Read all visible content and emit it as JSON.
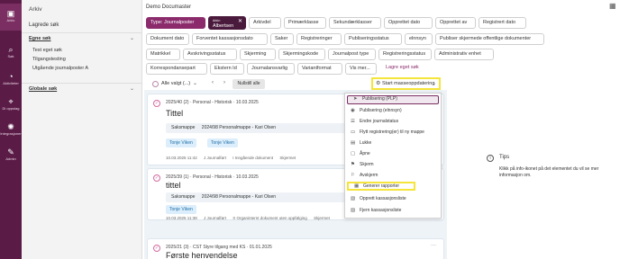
{
  "rail": [
    {
      "label": "Arkiv",
      "icon": "folder-icon",
      "glyph": "▣"
    },
    {
      "label": "Søk",
      "icon": "search-icon",
      "glyph": "⌕"
    },
    {
      "label": "Aktiviteter",
      "icon": "activity-icon",
      "glyph": "◔"
    },
    {
      "label": "Di oppslag",
      "icon": "map-pin-icon",
      "glyph": "⌖"
    },
    {
      "label": "Integrasjoner",
      "icon": "cog-icon",
      "glyph": "✺"
    },
    {
      "label": "Admin",
      "icon": "tools-icon",
      "glyph": "✎"
    }
  ],
  "left_panel": {
    "title": "Arkiv",
    "saved_search": "Lagrede søk",
    "own_section": "Egne søk",
    "own_items": [
      "Test eget søk",
      "Tilgangstesting",
      "Utgående journalposter A"
    ],
    "global_section": "Globale søk",
    "chevron": "⌄"
  },
  "header": {
    "title": "Demo Documaster",
    "icon_glyph": "▦"
  },
  "chips": {
    "type_filter": "Type: Journalposter",
    "owner_small": "Arkiv:",
    "owner_value": "Albertsen",
    "close": "✕",
    "row1": [
      "Arkivdel",
      "Primærklasse",
      "Sekundærklasser",
      "Opprettet dato",
      "Opprettet av",
      "Registrert dato"
    ],
    "row2": [
      "Dokument dato",
      "Forventet kassasjonsdato",
      "Saker",
      "Registreringer",
      "Publiseringsstatus",
      "elnnsyn",
      "Publiser skjermede offentlige dokumenter"
    ],
    "row3": [
      "Matrikkel",
      "Avskrivingsstatus",
      "Skjerming",
      "Skjermingskode",
      "Journalpost type",
      "Registreringsstatus",
      "Administrativ enhet"
    ],
    "row4": [
      "Korrespondansepart",
      "Ekstern Id",
      "Journalansvarlig",
      "Variantformat",
      "Vis mer..."
    ],
    "save_search": "Lagre eget søk"
  },
  "toolbar": {
    "select_all": "Alle valgt (...)",
    "select_all_chev": "⌄",
    "prev": "‹",
    "next": "›",
    "reset": "Nullstill alle",
    "mass_update": "Start masseoppdatering",
    "mass_cog": "⚙",
    "mass_chev": "⌄"
  },
  "cards": [
    {
      "check": "✓",
      "meta": "2025/40 (2)  ·  Personal - Historisk  ·  10.03.2025",
      "dots": "···",
      "title": "Tittel",
      "sub_label": "Saksmappe",
      "sub_value": "2024/98  Personalmappe - Kari Olsen",
      "tags": [
        "Tonje Viken",
        "Tonje Viken"
      ],
      "foot": [
        "10.03.2025 11:42",
        "J  Journalført",
        "I  Inngående dokument",
        "Skjermet"
      ]
    },
    {
      "check": "✓",
      "meta": "2025/39 (1)  ·  Personal - Historisk  ·  10.03.2025",
      "dots": "···",
      "title": "tittel",
      "sub_label": "Saksmappe",
      "sub_value": "2024/98  Personalmappe - Kari Olsen",
      "tags": [
        "Tonje Viken"
      ],
      "foot": [
        "10.03.2025 11:38",
        "J  Journalført",
        "X  Organinternt dokument uten oppfølging",
        "Skjermet"
      ]
    },
    {
      "check": "✓",
      "meta": "2025/21 (3)  ·  CST Styre tilgang med KS  ·  01.01.2025",
      "dots": "···",
      "title": "Første henvendelse"
    }
  ],
  "menu": [
    {
      "label": "Publisering (PLP)",
      "glyph": "➤"
    },
    {
      "label": "Publisering (elnnsyn)",
      "glyph": "◉"
    },
    {
      "label": "Endre journalstatus",
      "glyph": "☰"
    },
    {
      "label": "Flytt registrering(er) til ny mappe",
      "glyph": "▭"
    },
    {
      "label": "Lukke",
      "glyph": "▤"
    },
    {
      "label": "Åpne",
      "glyph": "▢"
    },
    {
      "label": "Skjerm",
      "glyph": "⚑"
    },
    {
      "label": "Avskjerm",
      "glyph": "⚐"
    },
    {
      "label": "Generer rapporter",
      "glyph": "▦"
    },
    {
      "label": "Opprett kassasjonsliste",
      "glyph": "▧"
    },
    {
      "label": "Fjern kassasjonsliste",
      "glyph": "▨"
    }
  ],
  "tips": {
    "icon_glyph": "i",
    "title": "Tips",
    "text": "Klikk på info-ikonet på det elementet du vil se mer informasjon om."
  },
  "colors": {
    "rail": "#5a1b47",
    "accent": "#8b2b6c",
    "highlight": "#f5e43a"
  }
}
